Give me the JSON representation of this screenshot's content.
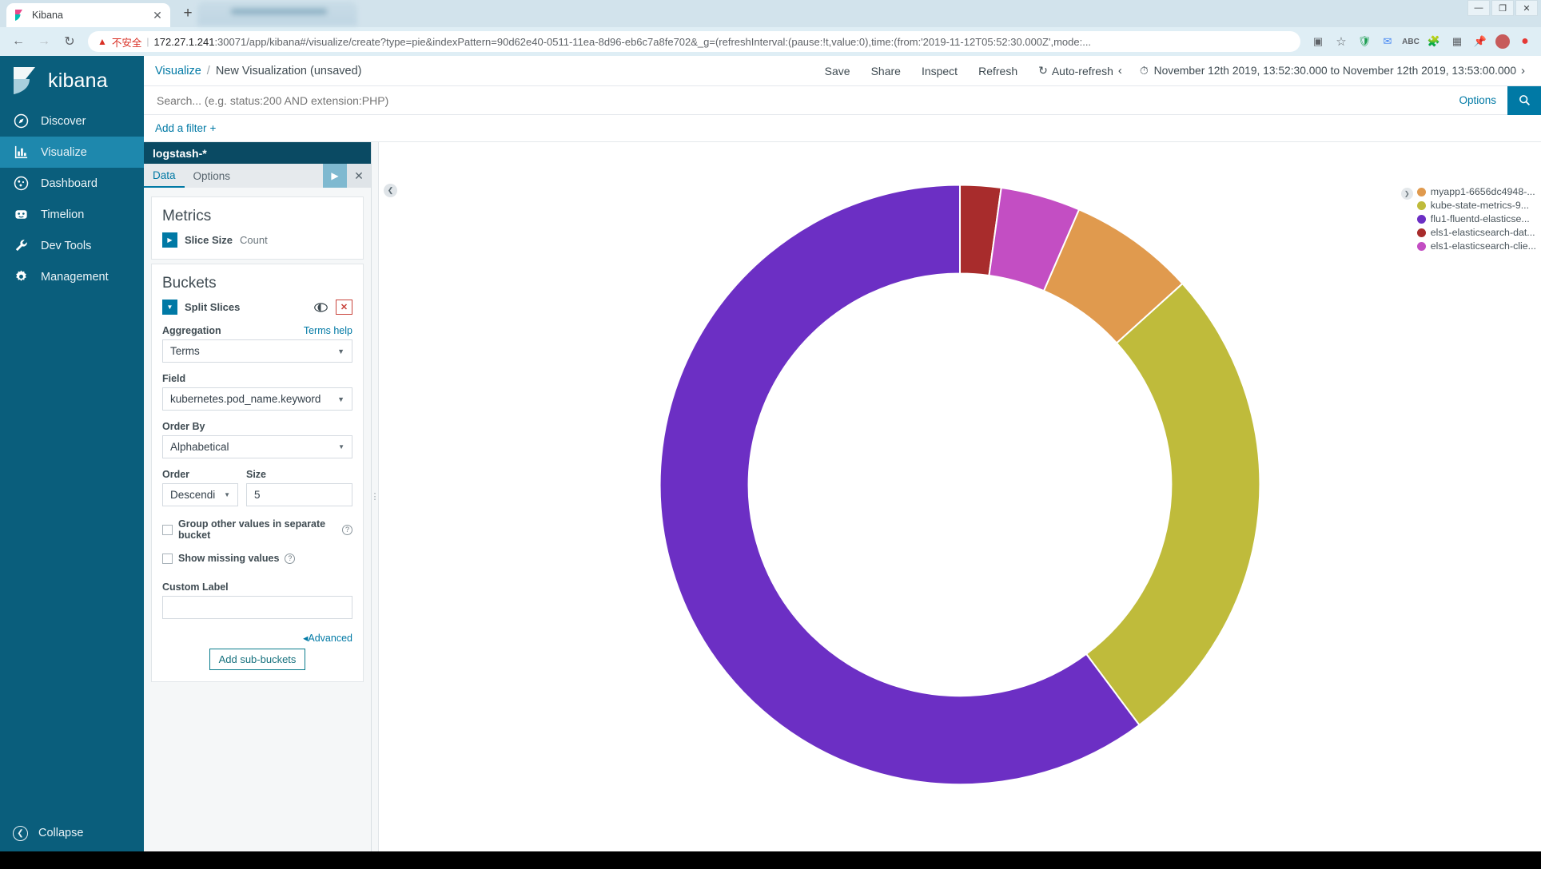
{
  "browser": {
    "tab": {
      "title": "Kibana",
      "favicon": "kibana-favicon",
      "close": "✕"
    },
    "newtab_label": "+",
    "nav": {
      "back": "←",
      "forward": "→",
      "reload": "↻"
    },
    "omnibox": {
      "warning_icon": "warning-triangle-icon",
      "not_secure": "不安全",
      "separator": "|",
      "url_host": "172.27.1.241",
      "url_rest": ":30071/app/kibana#/visualize/create?type=pie&indexPattern=90d62e40-0511-11ea-8d96-eb6c7a8fe702&_g=(refreshInterval:(pause:!t,value:0),time:(from:'2019-11-12T05:52:30.000Z',mode:..."
    },
    "window_controls": {
      "minimize": "—",
      "maximize": "❐",
      "close": "✕"
    }
  },
  "sidebar": {
    "brand": "kibana",
    "items": [
      {
        "label": "Discover",
        "icon": "compass-icon",
        "active": false
      },
      {
        "label": "Visualize",
        "icon": "bar-chart-icon",
        "active": true
      },
      {
        "label": "Dashboard",
        "icon": "dashboard-icon",
        "active": false
      },
      {
        "label": "Timelion",
        "icon": "timelion-icon",
        "active": false
      },
      {
        "label": "Dev Tools",
        "icon": "wrench-icon",
        "active": false
      },
      {
        "label": "Management",
        "icon": "gear-icon",
        "active": false
      }
    ],
    "collapse": {
      "label": "Collapse",
      "icon": "chevron-left-icon"
    }
  },
  "topbar": {
    "breadcrumb_root": "Visualize",
    "breadcrumb_sep": "/",
    "breadcrumb_current": "New Visualization (unsaved)",
    "actions": [
      {
        "label": "Save",
        "icon": null
      },
      {
        "label": "Share",
        "icon": null
      },
      {
        "label": "Inspect",
        "icon": null
      },
      {
        "label": "Refresh",
        "icon": null
      },
      {
        "label": "Auto-refresh",
        "icon": "refresh-cycle-icon"
      }
    ],
    "prev_arrow": "‹",
    "next_arrow": "›",
    "time_icon": "clock-icon",
    "time_range": "November 12th 2019, 13:52:30.000 to November 12th 2019, 13:53:00.000"
  },
  "query": {
    "placeholder": "Search... (e.g. status:200 AND extension:PHP)",
    "value": "",
    "options_label": "Options",
    "search_icon": "search-icon"
  },
  "filters": {
    "add_filter_label": "Add a filter",
    "add_icon": "+"
  },
  "editor": {
    "index_pattern": "logstash-*",
    "tabs": [
      {
        "label": "Data",
        "active": true
      },
      {
        "label": "Options",
        "active": false
      }
    ],
    "apply_icon": "play-icon",
    "discard_icon": "close-icon",
    "metrics": {
      "title": "Metrics",
      "agg_toggle_icon": "caret-right-icon",
      "label": "Slice Size",
      "value": "Count"
    },
    "buckets": {
      "title": "Buckets",
      "agg_toggle_icon": "caret-down-icon",
      "label": "Split Slices",
      "eye_icon": "eye-toggle-icon",
      "delete_icon": "remove-x-icon",
      "aggregation_label": "Aggregation",
      "aggregation_help": "Terms help",
      "aggregation_value": "Terms",
      "field_label": "Field",
      "field_value": "kubernetes.pod_name.keyword",
      "order_by_label": "Order By",
      "order_by_value": "Alphabetical",
      "order_label": "Order",
      "order_value": "Descendi",
      "size_label": "Size",
      "size_value": "5",
      "group_other_label": "Group other values in separate bucket",
      "group_other_checked": false,
      "show_missing_label": "Show missing values",
      "show_missing_checked": false,
      "custom_label_label": "Custom Label",
      "custom_label_value": "",
      "advanced_label": "Advanced",
      "advanced_caret": "◂",
      "add_sub_buckets_label": "Add sub-buckets",
      "help_icon": "question-mark-icon"
    }
  },
  "chart_panel": {
    "collapse_icon": "chevron-left-icon",
    "legend_toggle_icon": "chevron-right-icon"
  },
  "chart_data": {
    "type": "pie",
    "variant": "donut",
    "title": "",
    "legend_position": "right",
    "labels": [
      "myapp1-6656dc4948-...",
      "kube-state-metrics-9...",
      "flu1-fluentd-elasticse...",
      "els1-elasticsearch-dat...",
      "els1-elasticsearch-clie..."
    ],
    "colors": [
      "#e09a4e",
      "#bfbb3b",
      "#6c2fc4",
      "#a82c2c",
      "#c34ec3"
    ],
    "values": [
      6.8,
      26.5,
      60.2,
      2.2,
      4.3
    ],
    "xlabel": "",
    "ylabel": ""
  }
}
